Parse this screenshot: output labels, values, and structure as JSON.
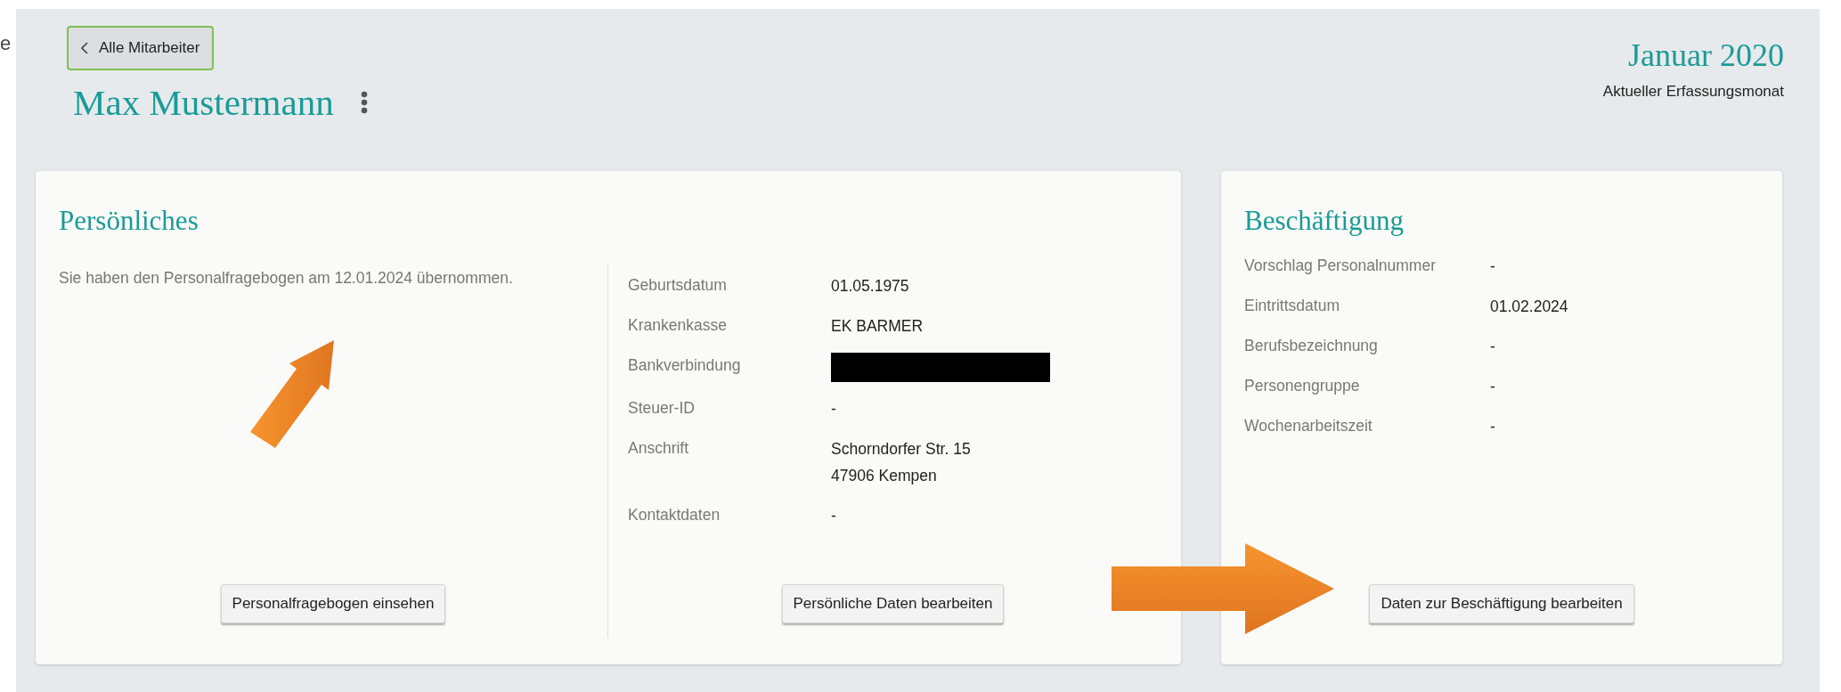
{
  "edge_text": "e",
  "back_button": {
    "label": "Alle Mitarbeiter"
  },
  "employee_name": "Max Mustermann",
  "period": {
    "month": "Januar 2020",
    "caption": "Aktueller Erfassungsmonat"
  },
  "personal": {
    "title": "Persönliches",
    "note": "Sie haben den Personalfragebogen am 12.01.2024 übernommen.",
    "note_button": "Personalfragebogen einsehen",
    "rows": [
      {
        "label": "Geburtsdatum",
        "kind": "text",
        "values": [
          "01.05.1975"
        ]
      },
      {
        "label": "Krankenkasse",
        "kind": "text",
        "values": [
          "EK BARMER"
        ]
      },
      {
        "label": "Bankverbindung",
        "kind": "redacted"
      },
      {
        "label": "Steuer-ID",
        "kind": "text",
        "values": [
          "-"
        ]
      },
      {
        "label": "Anschrift",
        "kind": "text",
        "values": [
          "Schorndorfer Str. 15",
          "47906 Kempen"
        ]
      },
      {
        "label": "Kontaktdaten",
        "kind": "text",
        "values": [
          "-"
        ]
      }
    ],
    "edit_button": "Persönliche Daten bearbeiten"
  },
  "employment": {
    "title": "Beschäftigung",
    "rows": [
      {
        "label": "Vorschlag Personalnummer",
        "kind": "text",
        "values": [
          "-"
        ]
      },
      {
        "label": "Eintrittsdatum",
        "kind": "text",
        "values": [
          "01.02.2024"
        ]
      },
      {
        "label": "Berufsbezeichnung",
        "kind": "text",
        "values": [
          "-"
        ]
      },
      {
        "label": "Personengruppe",
        "kind": "text",
        "values": [
          "-"
        ]
      },
      {
        "label": "Wochenarbeitszeit",
        "kind": "text",
        "values": [
          "-"
        ]
      }
    ],
    "edit_button": "Daten zur Beschäftigung bearbeiten"
  },
  "annotations": [
    {
      "kind": "arrow-diagonal"
    },
    {
      "kind": "arrow-right"
    }
  ]
}
